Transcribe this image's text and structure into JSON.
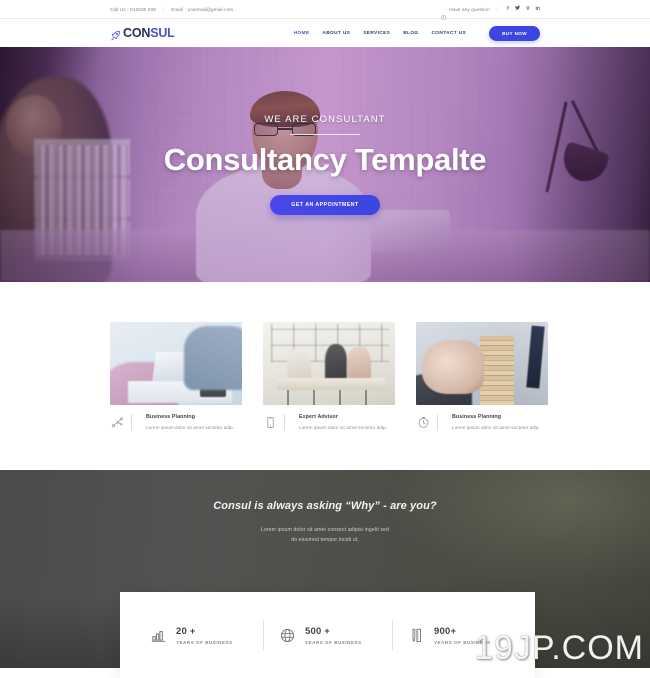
{
  "topbar": {
    "phone": "Call Us : 012036 039",
    "email": "Email : yourmail@gmail.com",
    "separator": "|",
    "question": "Have any question",
    "socials": [
      {
        "name": "facebook-icon",
        "glyph": "f"
      },
      {
        "name": "twitter-icon",
        "glyph": "✈"
      },
      {
        "name": "vimeo-icon",
        "glyph": "V"
      },
      {
        "name": "linkedin-icon",
        "glyph": "in"
      }
    ]
  },
  "header": {
    "logo_part1": "CON",
    "logo_part2": "SUL",
    "nav": [
      {
        "label": "HOME",
        "active": true
      },
      {
        "label": "ABOUT US",
        "active": false
      },
      {
        "label": "SERVICES",
        "active": false
      },
      {
        "label": "BLOG",
        "active": false
      },
      {
        "label": "CONTACT US",
        "active": false
      }
    ],
    "buy_label": "BUY NOW"
  },
  "hero": {
    "kicker": "WE ARE CONSULTANT",
    "title": "Consultancy Tempalte",
    "cta_label": "GET AN APPOINTMENT"
  },
  "services": {
    "cards": [
      {
        "icon": "network-nodes-icon",
        "title": "Business Planning",
        "desc": "Lorem ipsum dolor sit amet sectetur adip."
      },
      {
        "icon": "mobile-phone-icon",
        "title": "Expert Advisor",
        "desc": "Lorem ipsum dolor sit amet sectetur adip."
      },
      {
        "icon": "clock-icon",
        "title": "Business Planning",
        "desc": "Lorem ipsum dolor sit amet sectetur adip."
      }
    ]
  },
  "quote": {
    "title": "Consul is always asking “Why” - are you?",
    "line1": "Lorem ipsum dolor sit amet consect adipisi ingelit sed",
    "line2": "do eiusmod tempor incidi ut."
  },
  "stats": [
    {
      "icon": "bar-chart-icon",
      "number": "20 +",
      "label": "YEARS OF BUSINESS"
    },
    {
      "icon": "globe-icon",
      "number": "500 +",
      "label": "YEARS OF BUSINESS"
    },
    {
      "icon": "pen-ruler-icon",
      "number": "900+",
      "label": "YEARS OF BUSINESS"
    }
  ],
  "watermark": {
    "text": "19JP.COM"
  },
  "colors": {
    "accent": "#3b46e0",
    "logo_dark": "#2b2f55",
    "logo_purple": "#4a52c9",
    "dark_section": "#4b4b4b"
  }
}
